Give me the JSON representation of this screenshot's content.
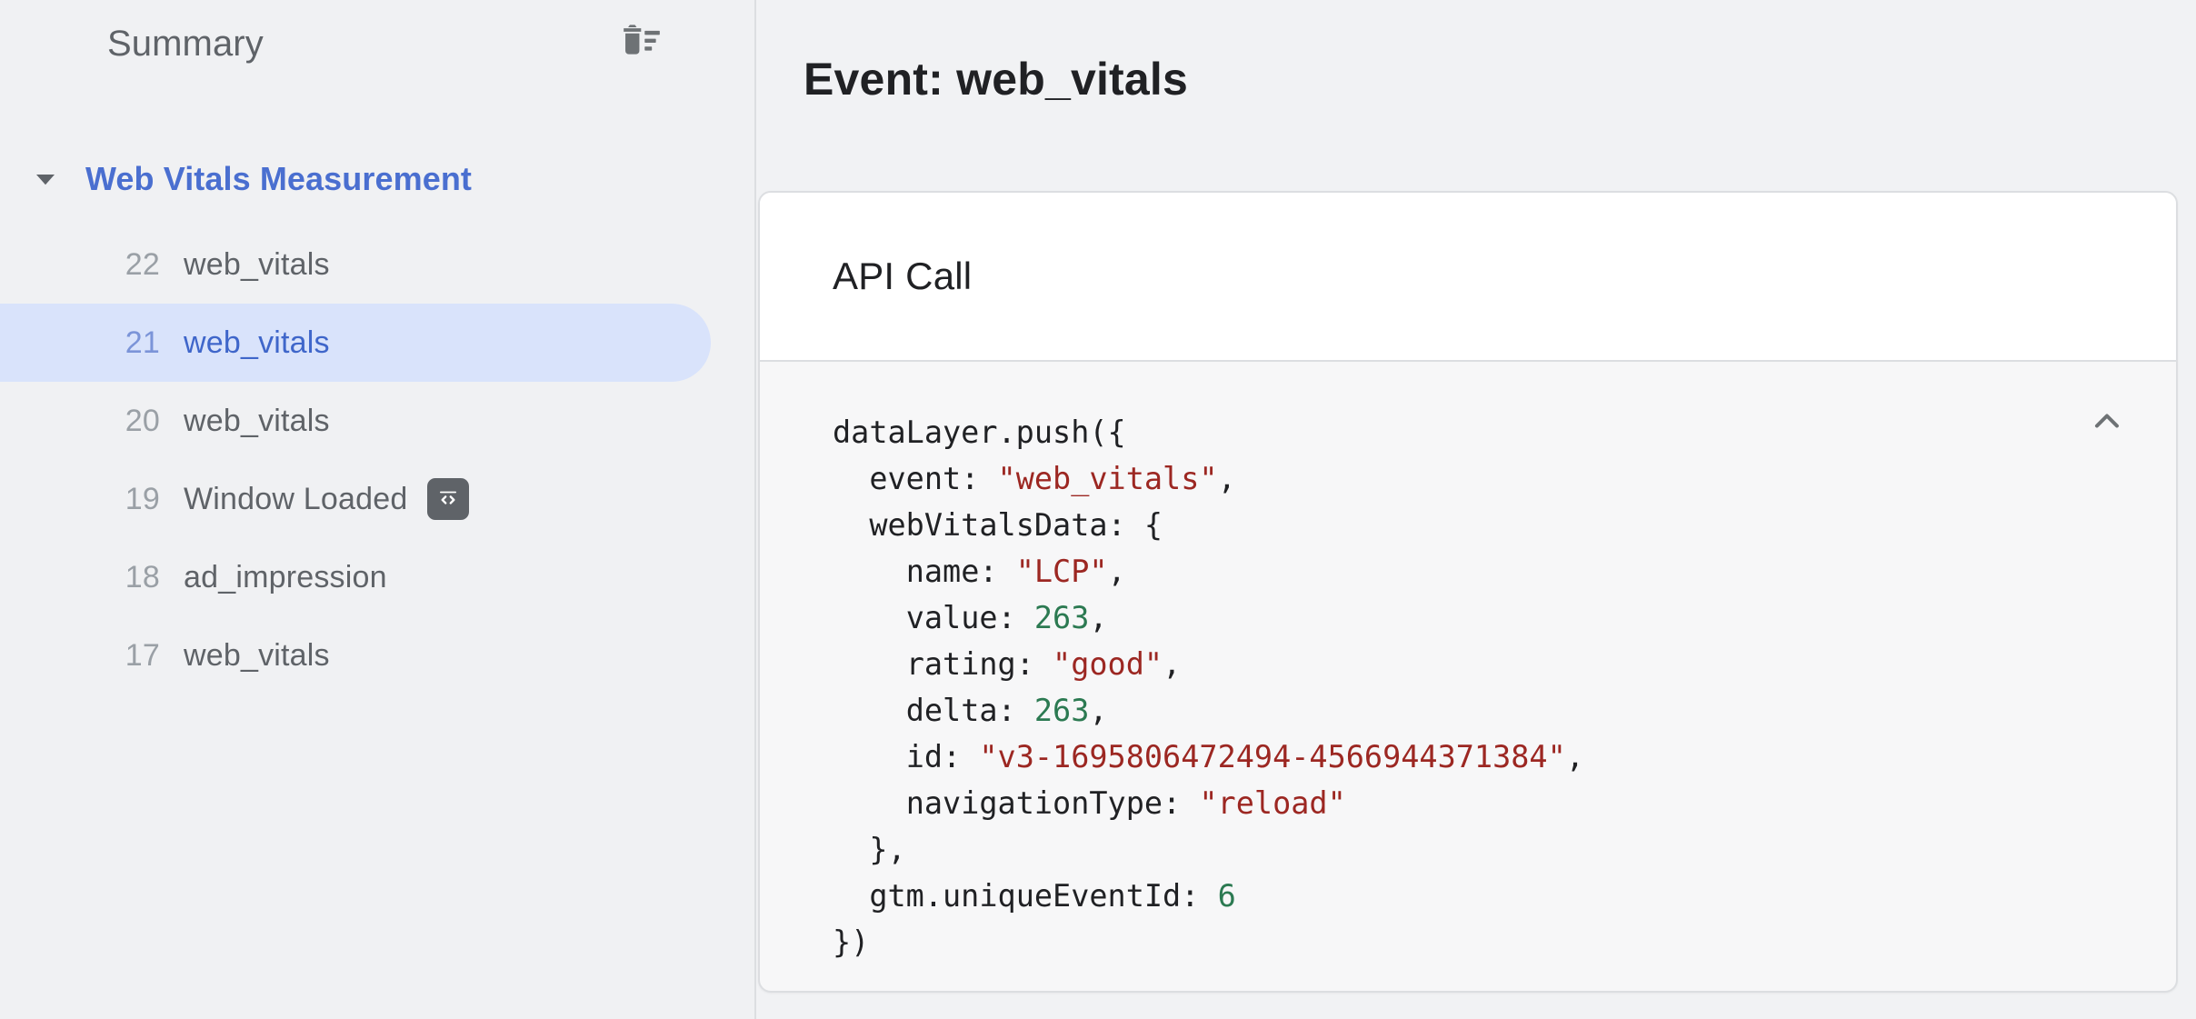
{
  "sidebar": {
    "title": "Summary",
    "clear_icon": "delete-sweep-icon",
    "group": {
      "label": "Web Vitals Measurement",
      "expanded": true,
      "caret_icon": "caret-down-icon"
    },
    "events": [
      {
        "num": "22",
        "label": "web_vitals",
        "selected": false,
        "badge": null
      },
      {
        "num": "21",
        "label": "web_vitals",
        "selected": true,
        "badge": null
      },
      {
        "num": "20",
        "label": "web_vitals",
        "selected": false,
        "badge": null
      },
      {
        "num": "19",
        "label": "Window Loaded",
        "selected": false,
        "badge": "code-badge-icon"
      },
      {
        "num": "18",
        "label": "ad_impression",
        "selected": false,
        "badge": null
      },
      {
        "num": "17",
        "label": "web_vitals",
        "selected": false,
        "badge": null
      }
    ]
  },
  "main": {
    "title": "Event: web_vitals",
    "card": {
      "header_title": "API Call",
      "collapse_icon": "chevron-up-icon",
      "code_lines": [
        {
          "indent": 0,
          "parts": [
            {
              "t": "punc",
              "v": "dataLayer.push({"
            }
          ]
        },
        {
          "indent": 1,
          "parts": [
            {
              "t": "key",
              "v": "event: "
            },
            {
              "t": "str",
              "v": "\"web_vitals\""
            },
            {
              "t": "punc",
              "v": ","
            }
          ]
        },
        {
          "indent": 1,
          "parts": [
            {
              "t": "key",
              "v": "webVitalsData: {"
            }
          ]
        },
        {
          "indent": 2,
          "parts": [
            {
              "t": "key",
              "v": "name: "
            },
            {
              "t": "str",
              "v": "\"LCP\""
            },
            {
              "t": "punc",
              "v": ","
            }
          ]
        },
        {
          "indent": 2,
          "parts": [
            {
              "t": "key",
              "v": "value: "
            },
            {
              "t": "num",
              "v": "263"
            },
            {
              "t": "punc",
              "v": ","
            }
          ]
        },
        {
          "indent": 2,
          "parts": [
            {
              "t": "key",
              "v": "rating: "
            },
            {
              "t": "str",
              "v": "\"good\""
            },
            {
              "t": "punc",
              "v": ","
            }
          ]
        },
        {
          "indent": 2,
          "parts": [
            {
              "t": "key",
              "v": "delta: "
            },
            {
              "t": "num",
              "v": "263"
            },
            {
              "t": "punc",
              "v": ","
            }
          ]
        },
        {
          "indent": 2,
          "parts": [
            {
              "t": "key",
              "v": "id: "
            },
            {
              "t": "str",
              "v": "\"v3-1695806472494-4566944371384\""
            },
            {
              "t": "punc",
              "v": ","
            }
          ]
        },
        {
          "indent": 2,
          "parts": [
            {
              "t": "key",
              "v": "navigationType: "
            },
            {
              "t": "str",
              "v": "\"reload\""
            }
          ]
        },
        {
          "indent": 1,
          "parts": [
            {
              "t": "punc",
              "v": "},"
            }
          ]
        },
        {
          "indent": 1,
          "parts": [
            {
              "t": "key",
              "v": "gtm.uniqueEventId: "
            },
            {
              "t": "num",
              "v": "6"
            }
          ]
        },
        {
          "indent": 0,
          "parts": [
            {
              "t": "punc",
              "v": "})"
            }
          ]
        }
      ]
    }
  },
  "colors": {
    "page_background": "#f1f2f4",
    "sidebar_background": "#f0f1f3",
    "accent_blue": "#4a6fd0",
    "selection_blue": "#d9e3fb",
    "text_primary": "#202124",
    "text_secondary": "#5f6368",
    "text_muted": "#9aa0a6",
    "string_token": "#9c2722",
    "number_token": "#2c7a52",
    "card_border": "#dcdee1",
    "card_body_background": "#f7f7f8"
  }
}
